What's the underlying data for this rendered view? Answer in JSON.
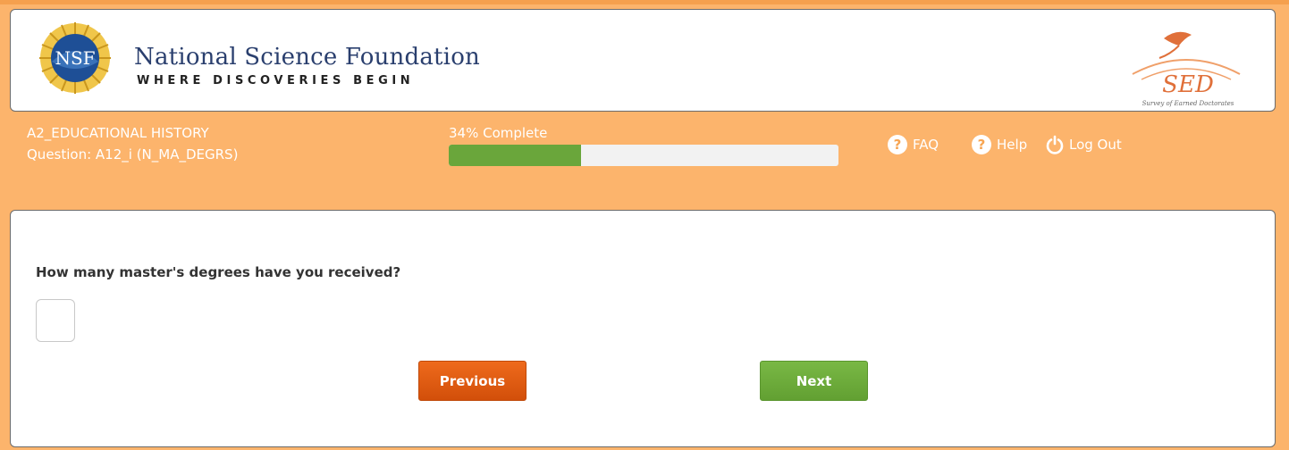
{
  "header": {
    "org_name": "National Science Foundation",
    "tagline": "WHERE DISCOVERIES BEGIN",
    "seal_text": "NSF",
    "survey_logo_text": "SED",
    "survey_logo_subtext": "Survey of Earned Doctorates"
  },
  "status": {
    "section": "A2_EDUCATIONAL HISTORY",
    "question_id": "Question: A12_i (N_MA_DEGRS)",
    "progress_label": "34% Complete",
    "progress_fraction": 0.34
  },
  "nav": {
    "faq": "FAQ",
    "help": "Help",
    "logout": "Log Out",
    "faq_icon": "question-circle-icon",
    "help_icon": "question-circle-icon",
    "logout_icon": "power-icon"
  },
  "question": {
    "text": "How many master's degrees have you received?",
    "answer_value": "",
    "answer_placeholder": ""
  },
  "buttons": {
    "previous": "Previous",
    "next": "Next"
  },
  "colors": {
    "page_bg": "#fcb46c",
    "progress_fill": "#6aa63b",
    "previous_btn": "#e05a10",
    "next_btn": "#6aa63b",
    "brand_text": "#2a3f6e"
  }
}
